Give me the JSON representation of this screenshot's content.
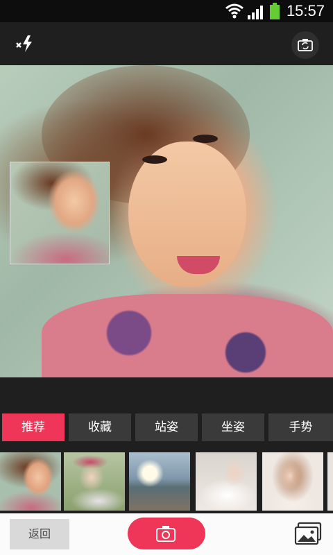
{
  "status_bar": {
    "time": "15:57"
  },
  "toolbar": {
    "flash_icon": "flash-off-icon",
    "switch_camera_icon": "camera-switch-icon"
  },
  "tabs": [
    {
      "label": "推荐",
      "active": true
    },
    {
      "label": "收藏",
      "active": false
    },
    {
      "label": "站姿",
      "active": false
    },
    {
      "label": "坐姿",
      "active": false
    },
    {
      "label": "手势",
      "active": false
    }
  ],
  "bottom_bar": {
    "back_label": "返回",
    "shutter_icon": "camera-icon",
    "gallery_icon": "gallery-icon"
  },
  "colors": {
    "accent": "#f03658",
    "tab_inactive": "#3a3a3a",
    "bar_bg": "#1f1f1f"
  }
}
